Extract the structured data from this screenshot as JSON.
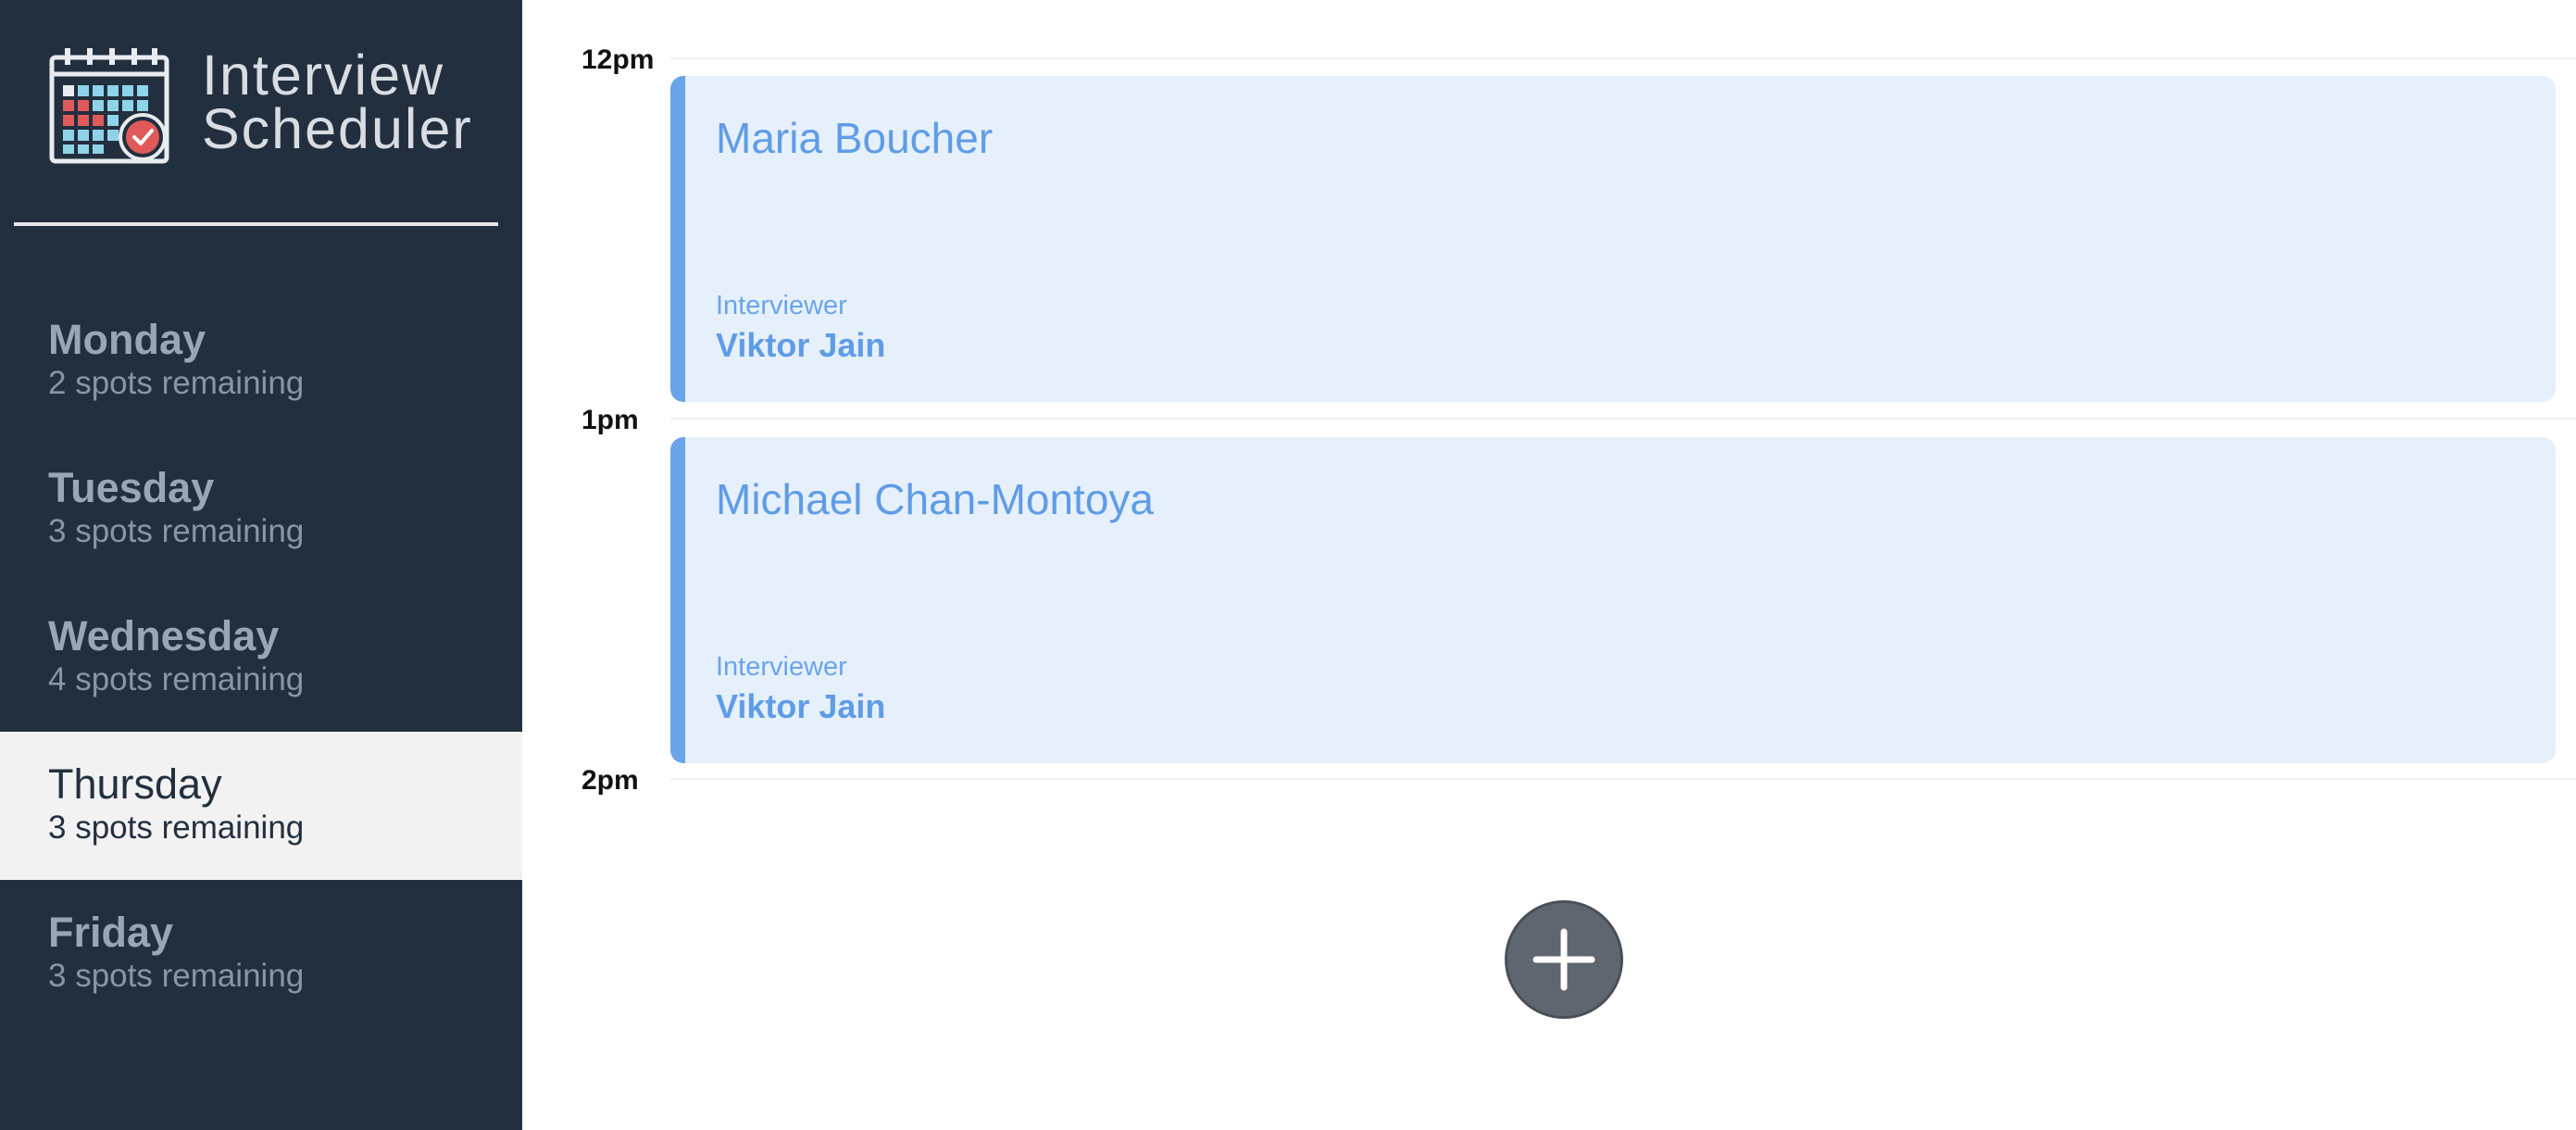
{
  "brand": {
    "title_line1": "Interview",
    "title_line2": "Scheduler",
    "logo_icon": "calendar-check-icon"
  },
  "days": [
    {
      "name": "Monday",
      "spots": "2 spots remaining",
      "selected": false
    },
    {
      "name": "Tuesday",
      "spots": "3 spots remaining",
      "selected": false
    },
    {
      "name": "Wednesday",
      "spots": "4 spots remaining",
      "selected": false
    },
    {
      "name": "Thursday",
      "spots": "3 spots remaining",
      "selected": true
    },
    {
      "name": "Friday",
      "spots": "3 spots remaining",
      "selected": false
    }
  ],
  "schedule": {
    "times": [
      "12pm",
      "1pm",
      "2pm"
    ],
    "appointments": [
      {
        "student": "Maria Boucher",
        "interviewer_label": "Interviewer",
        "interviewer": "Viktor Jain"
      },
      {
        "student": "Michael Chan-Montoya",
        "interviewer_label": "Interviewer",
        "interviewer": "Viktor Jain"
      }
    ],
    "add_icon": "plus-icon"
  },
  "colors": {
    "sidebar_bg": "#222f3e",
    "selected_day_bg": "#f2f2f2",
    "appointment_bg": "#e6f0fc",
    "appointment_accent": "#6aa4ea",
    "add_button_bg": "#5f6670"
  }
}
